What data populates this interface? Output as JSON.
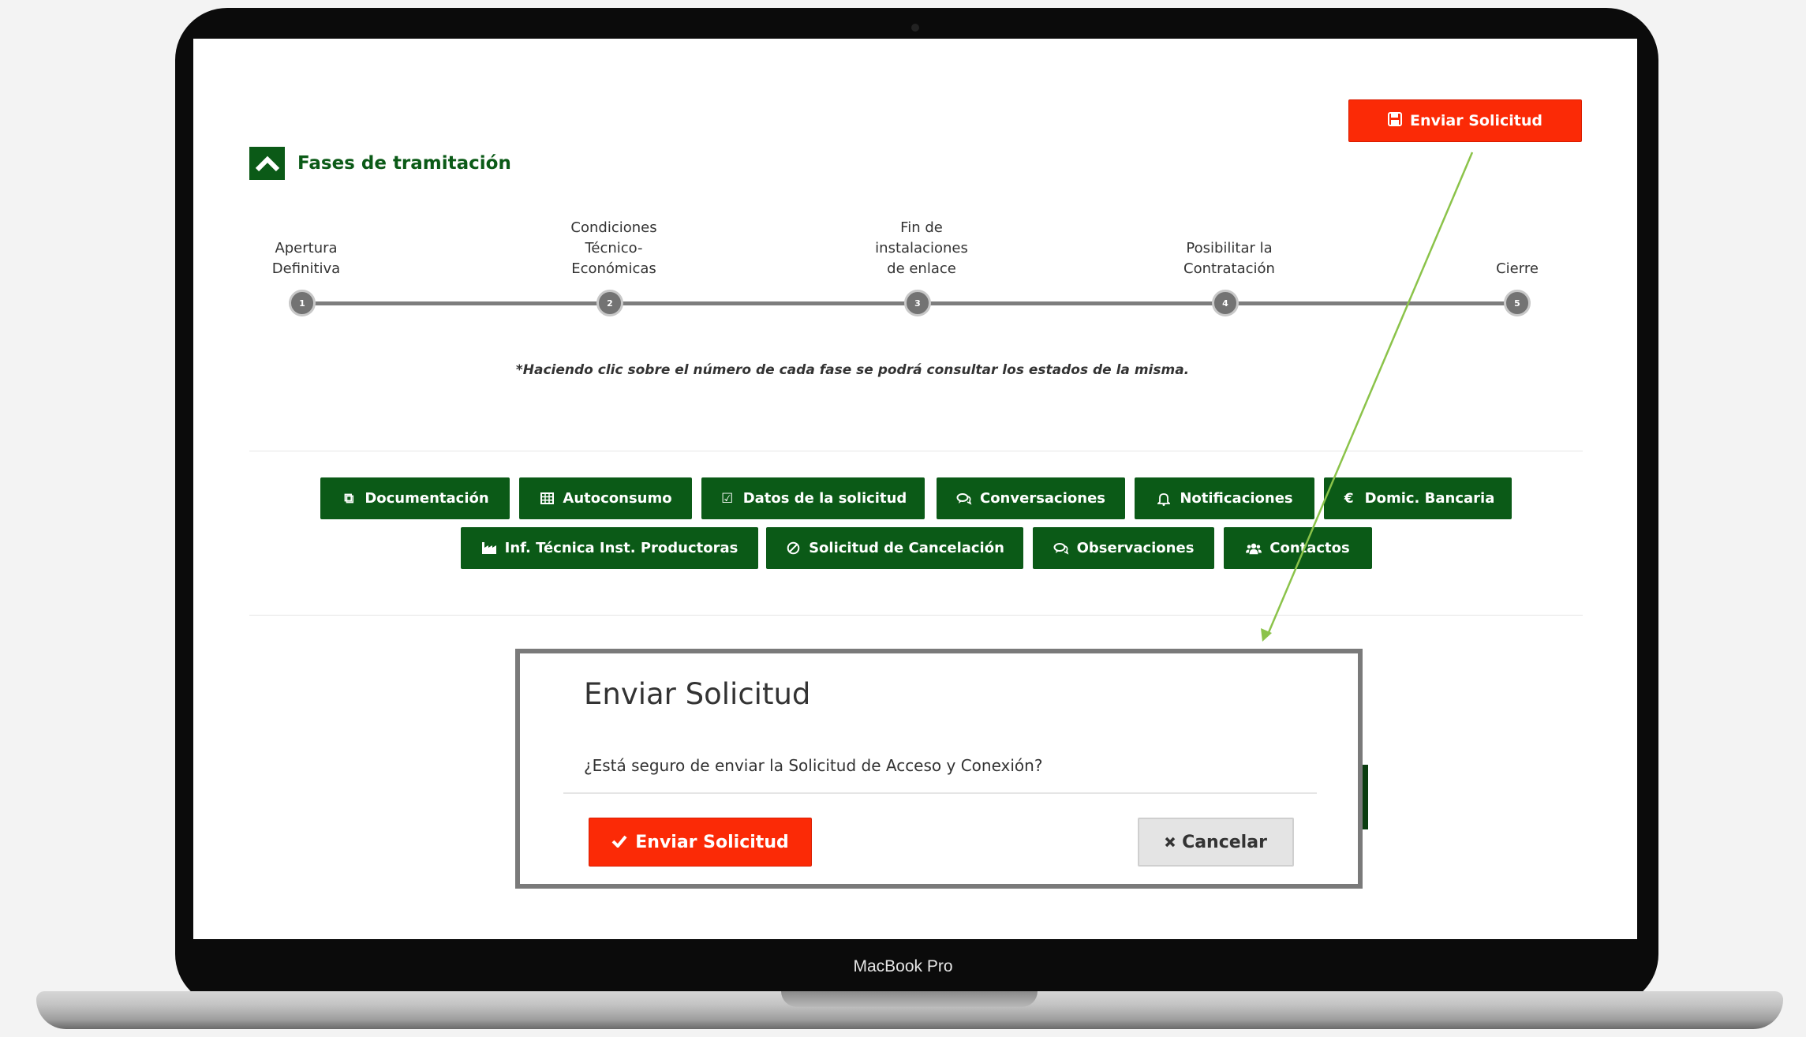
{
  "device": {
    "label": "MacBook Pro"
  },
  "header": {
    "send_button_label": "Enviar Solicitud",
    "section_title": "Fases de tramitación"
  },
  "phases": [
    {
      "number": "1",
      "label": "Apertura\nDefinitiva"
    },
    {
      "number": "2",
      "label": "Condiciones\nTécnico-\nEconómicas"
    },
    {
      "number": "3",
      "label": "Fin de\ninstalaciones\nde enlace"
    },
    {
      "number": "4",
      "label": "Posibilitar la\nContratación"
    },
    {
      "number": "5",
      "label": "Cierre"
    }
  ],
  "phase_hint": "*Haciendo clic sobre el número de cada fase se podrá consultar los estados de la misma.",
  "tabs_row1": [
    {
      "label": "Documentación",
      "icon": "copy-icon"
    },
    {
      "label": "Autoconsumo",
      "icon": "table-icon"
    },
    {
      "label": "Datos de la solicitud",
      "icon": "check-square-icon"
    },
    {
      "label": "Conversaciones",
      "icon": "comments-icon"
    },
    {
      "label": "Notificaciones",
      "icon": "bell-icon"
    },
    {
      "label": "Domic. Bancaria",
      "icon": "euro-icon"
    }
  ],
  "tabs_row2": [
    {
      "label": "Inf. Técnica Inst. Productoras",
      "icon": "industry-icon"
    },
    {
      "label": "Solicitud de Cancelación",
      "icon": "ban-icon"
    },
    {
      "label": "Observaciones",
      "icon": "comments-icon"
    },
    {
      "label": "Contactos",
      "icon": "users-icon"
    }
  ],
  "modal": {
    "title": "Enviar Solicitud",
    "question": "¿Está seguro de enviar la Solicitud de Acceso y Conexión?",
    "confirm_label": "Enviar Solicitud",
    "cancel_label": "Cancelar"
  },
  "colors": {
    "accent_red": "#fb2a06",
    "brand_green": "#0b5a17",
    "arrow_green": "#8bc34a"
  }
}
